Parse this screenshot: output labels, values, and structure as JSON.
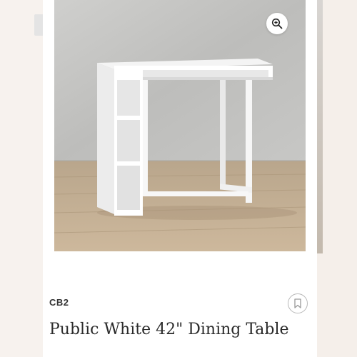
{
  "listing": {
    "brand": "CB2",
    "title": "Public White 42\" Dining Table"
  },
  "icons": {
    "zoom": "zoom-in-icon",
    "save": "bookmark-icon"
  },
  "colors": {
    "background": "#f7f2ee",
    "card": "#ffffff",
    "text": "#2a2a2a",
    "brand_text": "#333333"
  }
}
